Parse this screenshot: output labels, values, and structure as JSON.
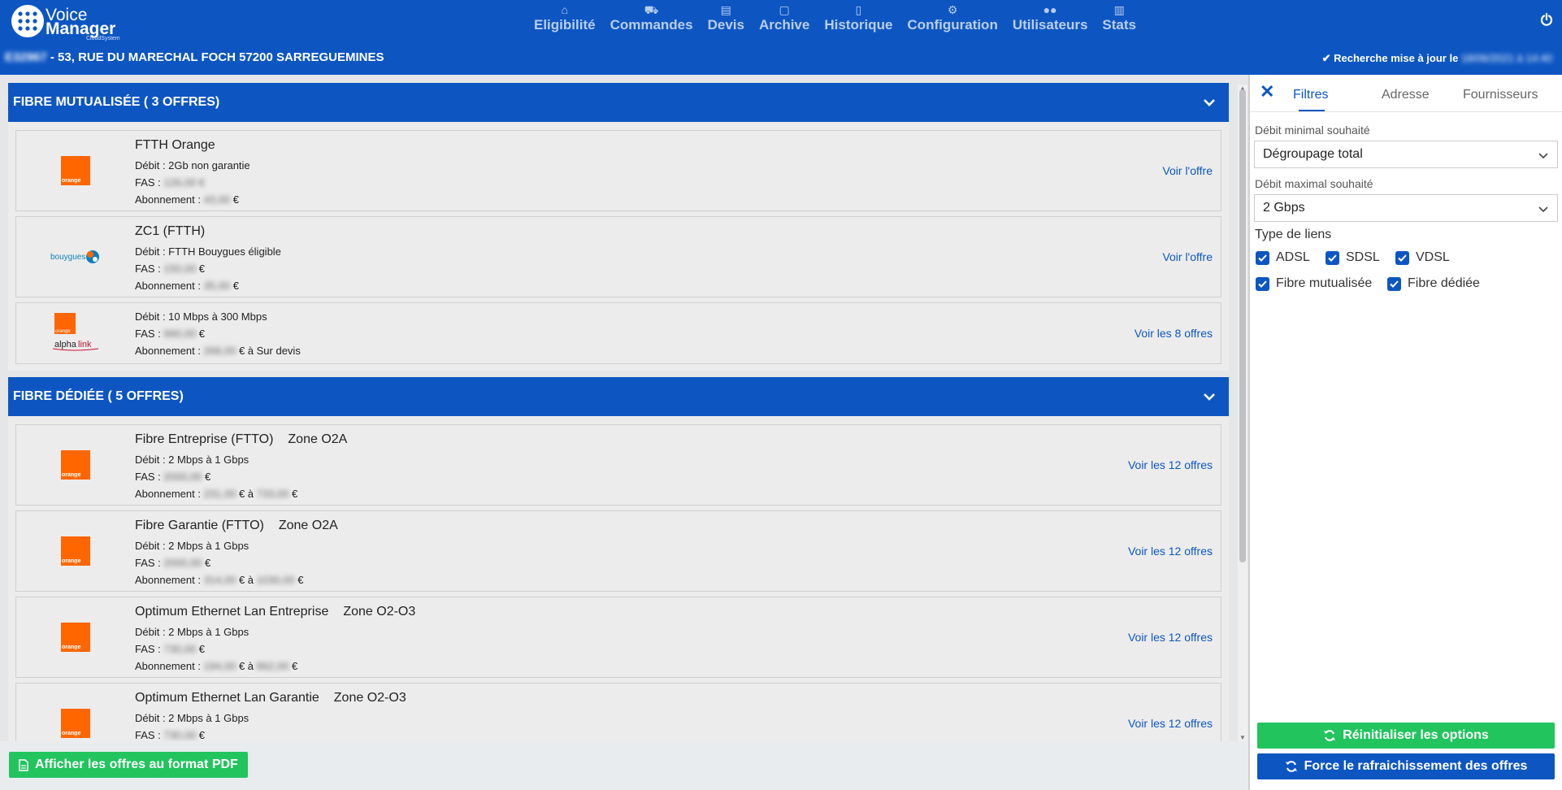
{
  "header": {
    "brand_line1": "Voice",
    "brand_line2": "Manager",
    "brand_line3": "CloudSystem",
    "nav": [
      {
        "label": "Eligibilité",
        "icon": "home-icon"
      },
      {
        "label": "Commandes",
        "icon": "cart-icon"
      },
      {
        "label": "Devis",
        "icon": "quote-icon"
      },
      {
        "label": "Archive",
        "icon": "archive-icon"
      },
      {
        "label": "Historique",
        "icon": "history-icon"
      },
      {
        "label": "Configuration",
        "icon": "gears-icon"
      },
      {
        "label": "Utilisateurs",
        "icon": "users-icon"
      },
      {
        "label": "Stats",
        "icon": "stats-icon"
      }
    ],
    "address_id": "E32967",
    "address": " - 53, RUE DU MARECHAL FOCH 57200 SARREGUEMINES",
    "update_label": "Recherche mise à jour le",
    "update_date": "18/06/2021 à 14:40"
  },
  "sections": [
    {
      "title": "FIBRE MUTUALISÉE ( 3 OFFRES)",
      "offers": [
        {
          "logo": "orange",
          "title": "FTTH Orange",
          "zone": "",
          "debit": "Débit : 2Gb non garantie",
          "fas_label": "FAS : ",
          "fas_value": "126,00 €",
          "fas_unit": "",
          "abo_label": "Abonnement : ",
          "abo_value": "43,00",
          "abo_unit": " €",
          "abo_to": "",
          "abo_unit2": "",
          "link": "Voir l'offre"
        },
        {
          "logo": "bouygues",
          "title": "ZC1 (FTTH)",
          "zone": "",
          "debit": "Débit : FTTH Bouygues éligible",
          "fas_label": "FAS : ",
          "fas_value": "150,00",
          "fas_unit": " €",
          "abo_label": "Abonnement : ",
          "abo_value": "35,00",
          "abo_unit": " €",
          "abo_to": "",
          "abo_unit2": "",
          "link": "Voir l'offre"
        },
        {
          "logo": "orange-alphalink",
          "title": "",
          "zone": "",
          "debit": "Débit : 10 Mbps à 300 Mbps",
          "fas_label": "FAS : ",
          "fas_value": "990,00",
          "fas_unit": " €",
          "abo_label": "Abonnement : ",
          "abo_value": "268,00",
          "abo_unit": " € à Sur devis",
          "abo_to": "",
          "abo_unit2": "",
          "link": "Voir les 8 offres"
        }
      ]
    },
    {
      "title": "FIBRE DÉDIÉE ( 5 OFFRES)",
      "offers": [
        {
          "logo": "orange",
          "title": "Fibre Entreprise (FTTO)",
          "zone": "Zone O2A",
          "debit": "Débit : 2 Mbps à 1 Gbps",
          "fas_label": "FAS : ",
          "fas_value": "2000,00",
          "fas_unit": " €",
          "abo_label": "Abonnement : ",
          "abo_value": "231,00",
          "abo_unit": " € à ",
          "abo_to": "733,00",
          "abo_unit2": " €",
          "link": "Voir les 12 offres"
        },
        {
          "logo": "orange",
          "title": "Fibre Garantie (FTTO)",
          "zone": "Zone O2A",
          "debit": "Débit : 2 Mbps à 1 Gbps",
          "fas_label": "FAS : ",
          "fas_value": "2000,00",
          "fas_unit": " €",
          "abo_label": "Abonnement : ",
          "abo_value": "314,00",
          "abo_unit": " € à ",
          "abo_to": "1030,00",
          "abo_unit2": " €",
          "link": "Voir les 12 offres"
        },
        {
          "logo": "orange",
          "title": "Optimum Ethernet Lan Entreprise",
          "zone": "Zone O2-O3",
          "debit": "Débit : 2 Mbps à 1 Gbps",
          "fas_label": "FAS : ",
          "fas_value": "730,00",
          "fas_unit": " €",
          "abo_label": "Abonnement : ",
          "abo_value": "194,00",
          "abo_unit": " € à ",
          "abo_to": "862,00",
          "abo_unit2": " €",
          "link": "Voir les 12 offres"
        },
        {
          "logo": "orange",
          "title": "Optimum Ethernet Lan Garantie",
          "zone": "Zone O2-O3",
          "debit": "Débit : 2 Mbps à 1 Gbps",
          "fas_label": "FAS : ",
          "fas_value": "730,00",
          "fas_unit": " €",
          "abo_label": "",
          "abo_value": "",
          "abo_unit": "",
          "abo_to": "",
          "abo_unit2": "",
          "link": "Voir les 12 offres"
        }
      ]
    }
  ],
  "pdf_button": "Afficher les offres au format PDF",
  "side": {
    "tabs": [
      "Filtres",
      "Adresse",
      "Fournisseurs"
    ],
    "min_label": "Débit minimal souhaité",
    "min_value": "Dégroupage total",
    "max_label": "Débit maximal souhaité",
    "max_value": "2 Gbps",
    "links_label": "Type de liens",
    "checkboxes": [
      {
        "label": "ADSL",
        "checked": true
      },
      {
        "label": "SDSL",
        "checked": true
      },
      {
        "label": "VDSL",
        "checked": true
      },
      {
        "label": "Fibre mutualisée",
        "checked": true
      },
      {
        "label": "Fibre dédiée",
        "checked": true
      }
    ],
    "reset_button": "Réinitialiser les options",
    "refresh_button": "Force le rafraichissement des offres"
  },
  "colors": {
    "primary": "#0d56c2",
    "success": "#22c45e",
    "orange": "#ff6600"
  }
}
